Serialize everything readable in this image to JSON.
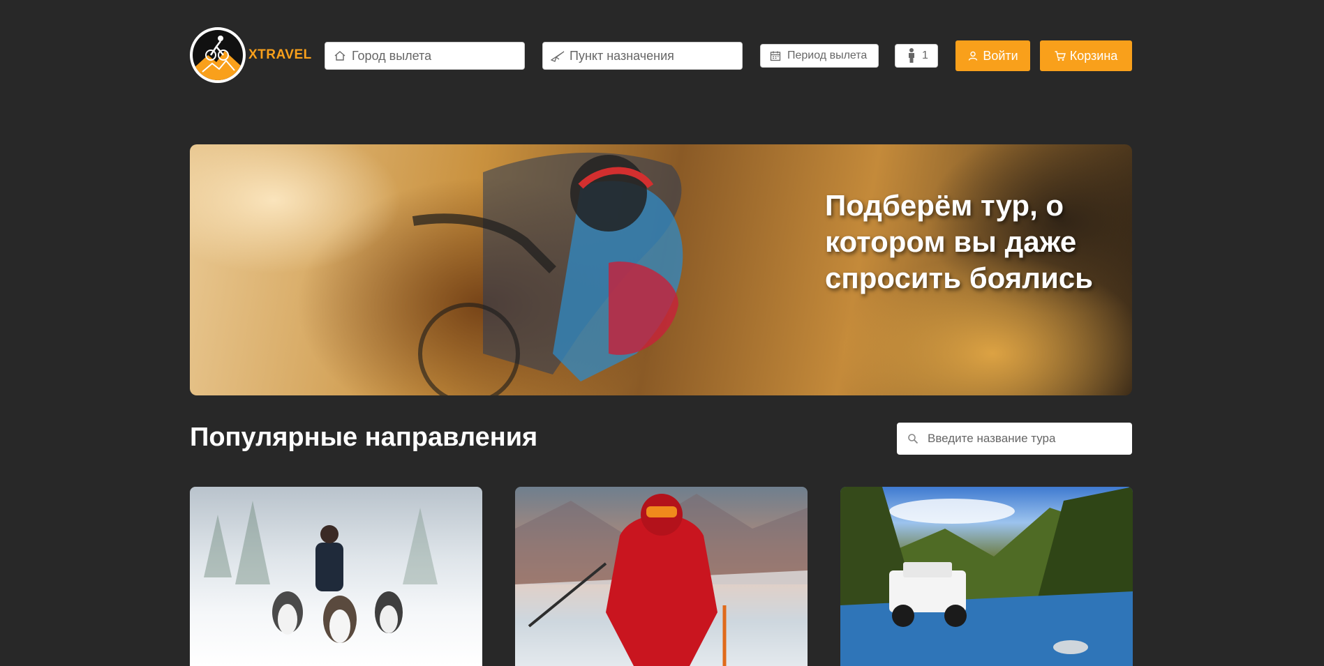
{
  "brand": {
    "name": "XTRAVEL",
    "accent": "#f9a01b",
    "background": "#282828"
  },
  "search_bar": {
    "departure_city": {
      "placeholder": "Город вылета",
      "icon": "home-icon"
    },
    "destination": {
      "placeholder": "Пункт назначения",
      "icon": "plane-icon"
    },
    "period": {
      "placeholder": "Период вылета",
      "icon": "calendar-icon"
    },
    "travelers": {
      "value": "1",
      "icon": "person-icon"
    }
  },
  "header_buttons": {
    "login": {
      "label": "Войти",
      "icon": "user-icon"
    },
    "cart": {
      "label": "Корзина",
      "icon": "cart-icon"
    }
  },
  "hero": {
    "title": "Подберём тур, о котором вы даже спросить боялись"
  },
  "popular": {
    "title": "Популярные направления",
    "search_placeholder": "Введите название тура"
  }
}
